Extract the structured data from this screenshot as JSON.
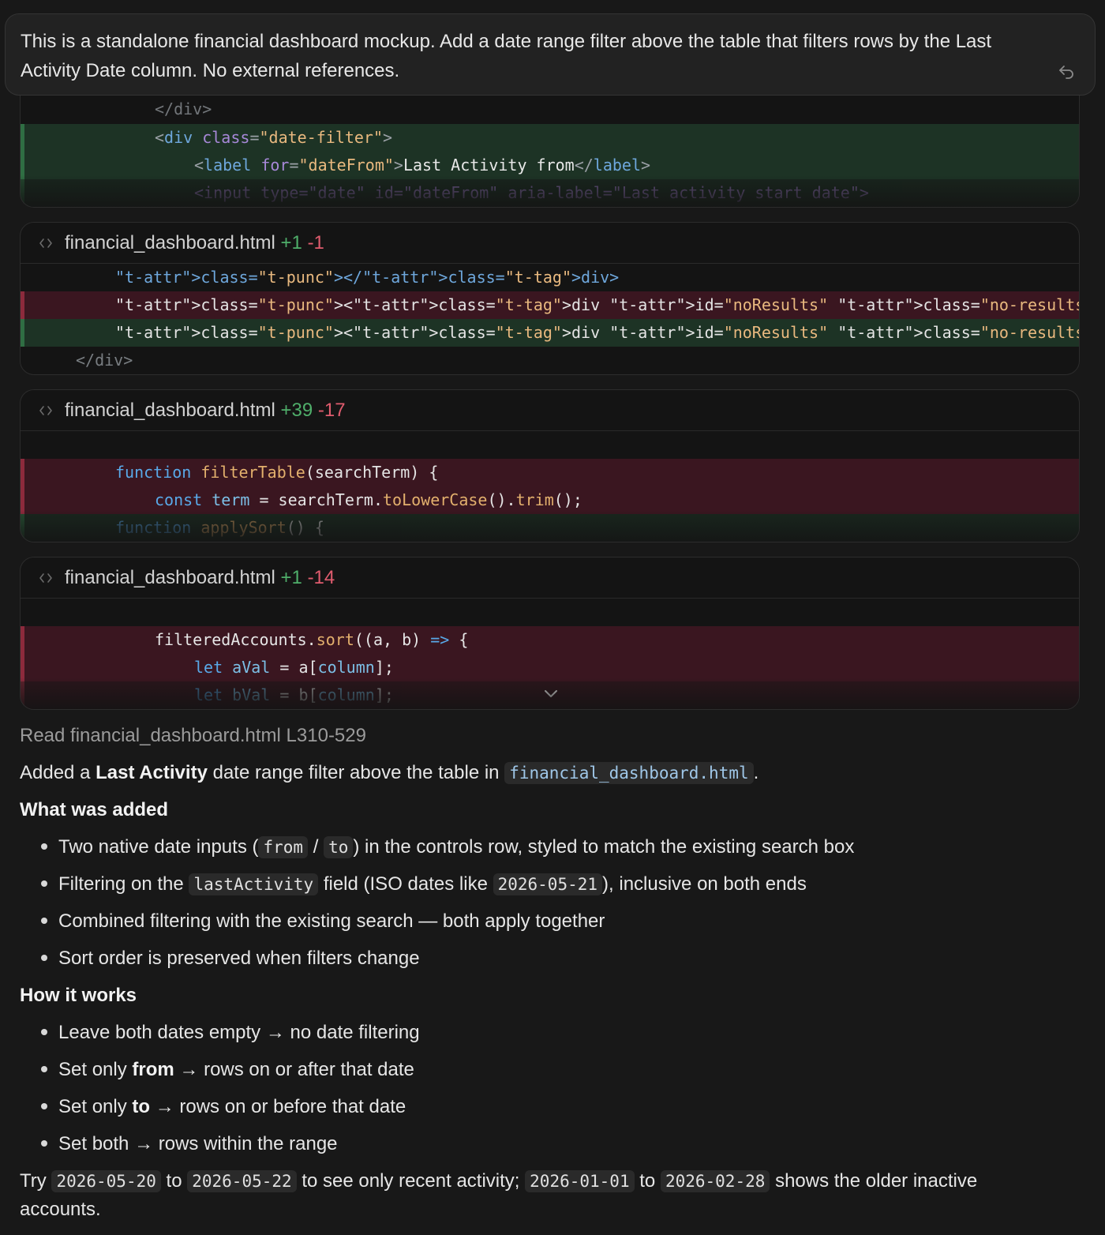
{
  "prompt": {
    "text": "This is a standalone financial dashboard mockup. Add a date range filter above the table that filters rows by the Last Activity Date column. No external references."
  },
  "top_snippet": {
    "line1": "</div>",
    "line2": {
      "open": "<",
      "tag": "div",
      "attr": "class",
      "eq": "=",
      "val": "\"date-filter\"",
      "close": ">"
    },
    "line3": {
      "open": "<",
      "tag": "label",
      "attr": "for",
      "eq": "=",
      "val": "\"dateFrom\"",
      "gt": ">",
      "text": "Last Activity from",
      "endopen": "</",
      "endtag": "label",
      "endclose": ">"
    },
    "line4": "<input type=\"date\" id=\"dateFrom\" aria-label=\"Last activity start date\">"
  },
  "cards": [
    {
      "filename": "financial_dashboard.html",
      "plus": "+1",
      "minus": "-1",
      "lines": [
        "</div>",
        "<div id=\"noResults\" class=\"no-results\" style=\"display: none;\">No accounts found matching your sea",
        "<div id=\"noResults\" class=\"no-results\" style=\"display: none;\">No accounts found matching your fil",
        "</div>"
      ]
    },
    {
      "filename": "financial_dashboard.html",
      "plus": "+39",
      "minus": "-17",
      "lines": [
        "function filterTable(searchTerm) {",
        "const term = searchTerm.toLowerCase().trim();",
        "function applySort() {"
      ]
    },
    {
      "filename": "financial_dashboard.html",
      "plus": "+1",
      "minus": "-14",
      "lines": [
        "filteredAccounts.sort((a, b) => {",
        "let aVal = a[column];",
        "let bVal = b[column];"
      ]
    }
  ],
  "response": {
    "read_prefix": "Read",
    "read_file": "financial_dashboard.html L310-529",
    "summary_pre": "Added a",
    "summary_bold": "Last Activity",
    "summary_mid": "date range filter above the table in",
    "summary_file": "financial_dashboard.html",
    "summary_end": ".",
    "h_added": "What was added",
    "added": {
      "b1_pre": "Two native date inputs (",
      "b1_from": "from",
      "b1_slash": "/",
      "b1_to": "to",
      "b1_post": ") in the controls row, styled to match the existing search box",
      "b2_pre": "Filtering on the",
      "b2_code": "lastActivity",
      "b2_mid": "field (ISO dates like",
      "b2_code2": "2026-05-21",
      "b2_post": "), inclusive on both ends",
      "b3": "Combined filtering with the existing search — both apply together",
      "b4": "Sort order is preserved when filters change"
    },
    "h_how": "How it works",
    "how": {
      "b1": "Leave both dates empty → no date filtering",
      "b2_pre": "Set only",
      "b2_bold": "from",
      "b2_post": "→ rows on or after that date",
      "b3_pre": "Set only",
      "b3_bold": "to",
      "b3_post": "→ rows on or before that date",
      "b4": "Set both → rows within the range"
    },
    "try": {
      "pre": "Try",
      "d1": "2026-05-20",
      "to1": "to",
      "d2": "2026-05-22",
      "mid": "to see only recent activity;",
      "d3": "2026-01-01",
      "to2": "to",
      "d4": "2026-02-28",
      "post": "shows the older inactive",
      "line2": "accounts."
    }
  },
  "icons": {
    "undo": "undo-icon",
    "code": "code-icon",
    "expand": "chevron-down-icon"
  }
}
